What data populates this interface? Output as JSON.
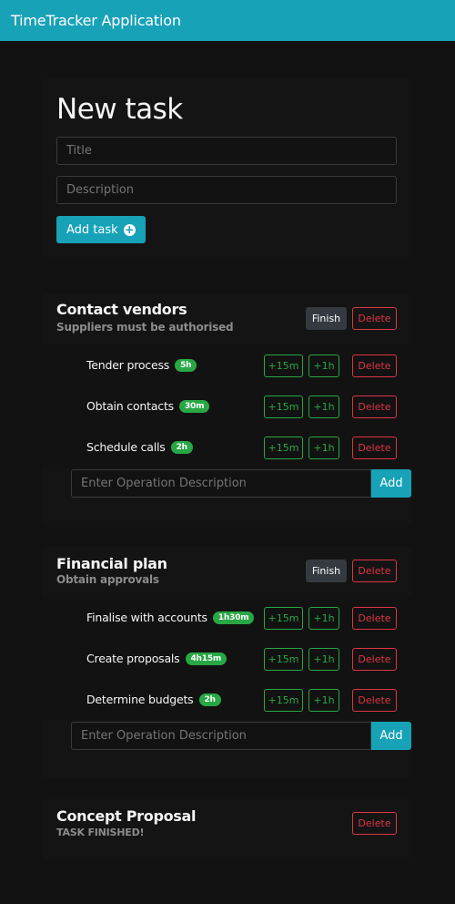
{
  "navbar": {
    "title": "TimeTracker Application"
  },
  "new_task": {
    "heading": "New task",
    "title_placeholder": "Title",
    "description_placeholder": "Description",
    "add_label": "Add task"
  },
  "labels": {
    "finish": "Finish",
    "delete": "Delete",
    "plus15": "+15m",
    "plus1h": "+1h",
    "op_placeholder": "Enter Operation Description",
    "add": "Add"
  },
  "tasks": [
    {
      "title": "Contact vendors",
      "description": "Suppliers must be authorised",
      "finished": false,
      "operations": [
        {
          "name": "Tender process",
          "time": "5h"
        },
        {
          "name": "Obtain contacts",
          "time": "30m"
        },
        {
          "name": "Schedule calls",
          "time": "2h"
        }
      ]
    },
    {
      "title": "Financial plan",
      "description": "Obtain approvals",
      "finished": false,
      "operations": [
        {
          "name": "Finalise with accounts",
          "time": "1h30m"
        },
        {
          "name": "Create proposals",
          "time": "4h15m"
        },
        {
          "name": "Determine budgets",
          "time": "2h"
        }
      ]
    },
    {
      "title": "Concept Proposal",
      "description": "TASK FINISHED!",
      "finished": true,
      "operations": []
    }
  ],
  "colors": {
    "accent": "#17a2b8",
    "success": "#28a745",
    "danger": "#dc3545",
    "dark": "#343a40"
  }
}
